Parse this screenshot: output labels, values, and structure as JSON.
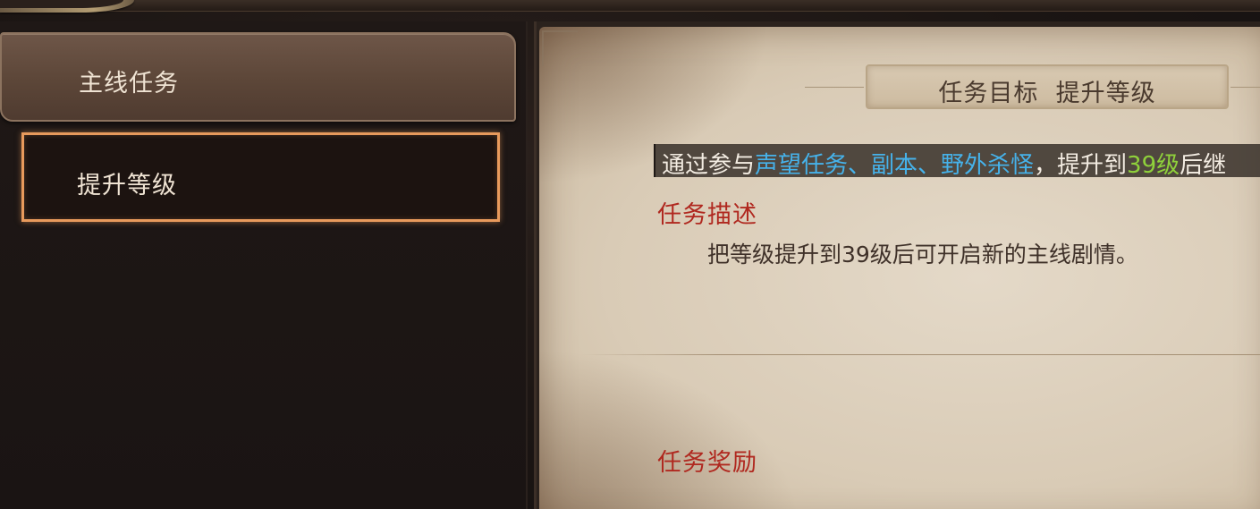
{
  "sidebar": {
    "category_label": "主线任务",
    "selected_quest_label": "提升等级"
  },
  "quest_panel": {
    "title": "任务目标  提升等级",
    "objective": {
      "part1": "通过参与",
      "highlight_blue": "声望任务、副本、野外杀怪",
      "part2": "，提升到",
      "highlight_green": "39级",
      "part3": "后继"
    },
    "description_heading": "任务描述",
    "description_text": "把等级提升到39级后可开启新的主线剧情。",
    "reward_heading": "任务奖励"
  },
  "colors": {
    "highlight_blue": "#46b2ea",
    "highlight_green": "#8fd13b",
    "heading_red": "#b0281f",
    "selected_border": "#e89a5c"
  }
}
